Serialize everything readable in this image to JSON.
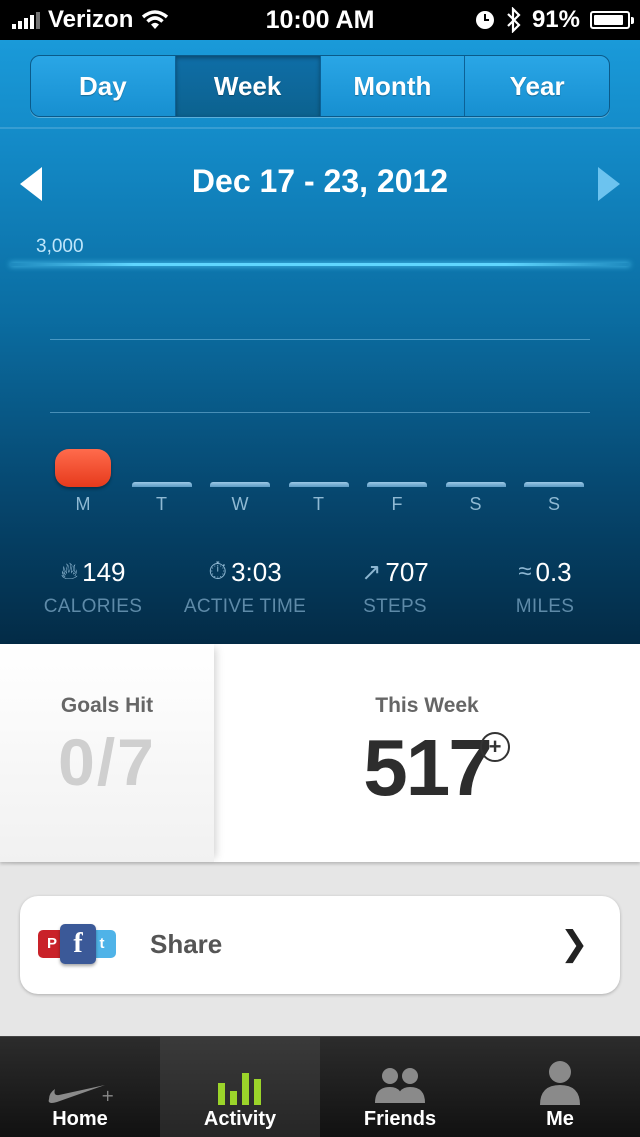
{
  "status_bar": {
    "carrier": "Verizon",
    "time": "10:00 AM",
    "battery": "91%",
    "battery_level": 0.91
  },
  "segmented_control": {
    "options": [
      "Day",
      "Week",
      "Month",
      "Year"
    ],
    "selected": "Week"
  },
  "date_range": "Dec 17 - 23, 2012",
  "chart_data": {
    "type": "bar",
    "categories": [
      "M",
      "T",
      "W",
      "T",
      "F",
      "S",
      "S"
    ],
    "values": [
      517,
      0,
      0,
      0,
      0,
      0,
      0
    ],
    "goal_label": "3,000",
    "goal_value": 3000,
    "ylim": [
      0,
      3000
    ],
    "grid": true
  },
  "stats": [
    {
      "value": "149",
      "label": "CALORIES",
      "icon": "flame-icon"
    },
    {
      "value": "3:03",
      "label": "ACTIVE TIME",
      "icon": "stopwatch-icon"
    },
    {
      "value": "707",
      "label": "STEPS",
      "icon": "shoe-icon"
    },
    {
      "value": "0.3",
      "label": "MILES",
      "icon": "path-icon"
    }
  ],
  "summary": {
    "goals_title": "Goals Hit",
    "goals_value": "0/7",
    "week_title": "This Week",
    "week_value": "517"
  },
  "share": {
    "label": "Share"
  },
  "tab_bar": {
    "tabs": [
      {
        "label": "Home",
        "icon": "nike-swoosh-icon"
      },
      {
        "label": "Activity",
        "icon": "activity-bars-icon"
      },
      {
        "label": "Friends",
        "icon": "friends-icon"
      },
      {
        "label": "Me",
        "icon": "person-icon"
      }
    ],
    "selected": "Activity"
  },
  "colors": {
    "accent_blue": "#1a9ad9",
    "fuel_bar_red": "#ff5a3c",
    "activity_green": "#9bd42a"
  }
}
